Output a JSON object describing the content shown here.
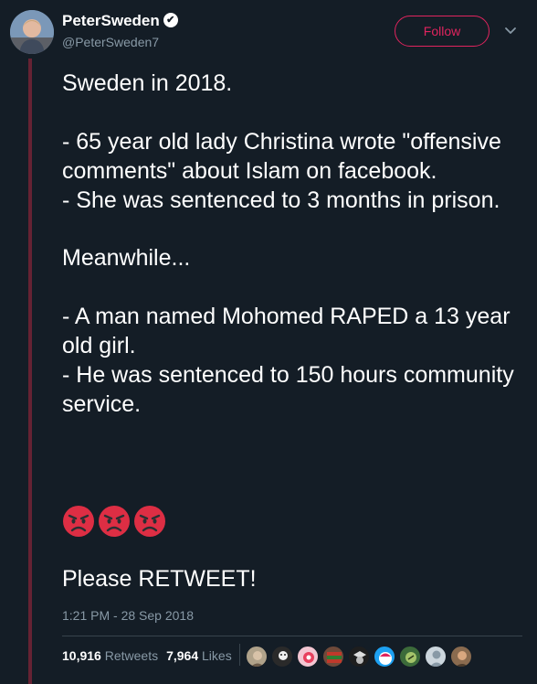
{
  "user": {
    "display_name": "PeterSweden",
    "handle": "@PeterSweden7",
    "verified": true,
    "avatar_icon": "profile-photo"
  },
  "actions": {
    "follow_label": "Follow",
    "more_icon": "chevron-down-icon"
  },
  "tweet": {
    "text": "Sweden in 2018.\n\n- 65 year old lady Christina wrote \"offensive comments\" about Islam on facebook.\n- She was sentenced to 3 months in prison.\n\nMeanwhile...\n\n- A man named Mohomed RAPED a 13 year old girl.\n- He was sentenced to 150 hours community service.",
    "emojis": [
      "angry-face-emoji",
      "angry-face-emoji",
      "angry-face-emoji"
    ],
    "cta": "Please RETWEET!",
    "timestamp": "1:21 PM - 28 Sep 2018"
  },
  "stats": {
    "retweets_count": "10,916",
    "retweets_label": "Retweets",
    "likes_count": "7,964",
    "likes_label": "Likes"
  },
  "colors": {
    "background": "#141d26",
    "accent": "#e0245e",
    "muted": "#8899a6",
    "thread_line": "#662233"
  }
}
